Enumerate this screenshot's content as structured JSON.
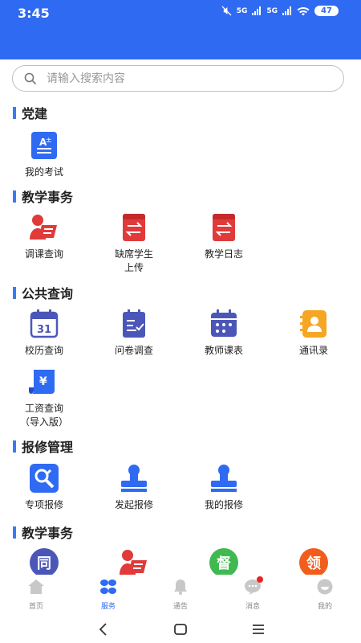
{
  "status": {
    "time": "3:45",
    "signal1": "5G",
    "signal2": "5G",
    "battery": "47"
  },
  "search": {
    "placeholder": "请输入搜索内容"
  },
  "sections": [
    {
      "title": "党建",
      "items": [
        {
          "label": "我的考试",
          "icon": "exam-icon"
        }
      ]
    },
    {
      "title": "教学事务",
      "items": [
        {
          "label": "调课查询",
          "icon": "course-adjust-icon"
        },
        {
          "label": "缺席学生\n上传",
          "icon": "absent-upload-icon"
        },
        {
          "label": "教学日志",
          "icon": "teaching-log-icon"
        }
      ]
    },
    {
      "title": "公共查询",
      "items": [
        {
          "label": "校历查询",
          "icon": "calendar-31-icon"
        },
        {
          "label": "问卷调查",
          "icon": "survey-icon"
        },
        {
          "label": "教师课表",
          "icon": "schedule-icon"
        },
        {
          "label": "通讯录",
          "icon": "contacts-icon"
        },
        {
          "label": "工资查询\n（导入版）",
          "icon": "salary-icon"
        }
      ]
    },
    {
      "title": "报修管理",
      "items": [
        {
          "label": "专项报修",
          "icon": "repair-tools-icon"
        },
        {
          "label": "发起报修",
          "icon": "stamp-icon"
        },
        {
          "label": "我的报修",
          "icon": "stamp-icon"
        }
      ]
    },
    {
      "title": "教学事务",
      "items": [
        {
          "label": "",
          "icon": "同",
          "glyph": "同"
        },
        {
          "label": "",
          "icon": "course-adjust-icon"
        },
        {
          "label": "",
          "icon": "督",
          "glyph": "督"
        },
        {
          "label": "",
          "icon": "领",
          "glyph": "领"
        }
      ]
    }
  ],
  "tabs": [
    {
      "label": "首页",
      "icon": "home-icon"
    },
    {
      "label": "服务",
      "icon": "service-icon",
      "active": true
    },
    {
      "label": "通告",
      "icon": "bell-icon"
    },
    {
      "label": "消息",
      "icon": "message-icon"
    },
    {
      "label": "我的",
      "icon": "profile-icon"
    }
  ],
  "colors": {
    "brand": "#2f6af2",
    "red": "#e03a3a",
    "purple": "#4b57b8",
    "orange": "#f5a623",
    "green": "#3fb950"
  }
}
